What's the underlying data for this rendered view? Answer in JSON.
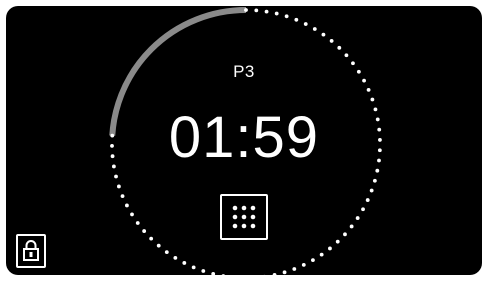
{
  "program": {
    "label": "P3"
  },
  "timer": {
    "value": "01:59"
  },
  "progress": {
    "remaining_fraction": 0.76
  },
  "icons": {
    "keypad": "keypad-grid-icon",
    "lock": "padlock-icon"
  },
  "colors": {
    "background": "#000000",
    "foreground": "#ffffff",
    "ring_track": "#8a8a8a"
  }
}
